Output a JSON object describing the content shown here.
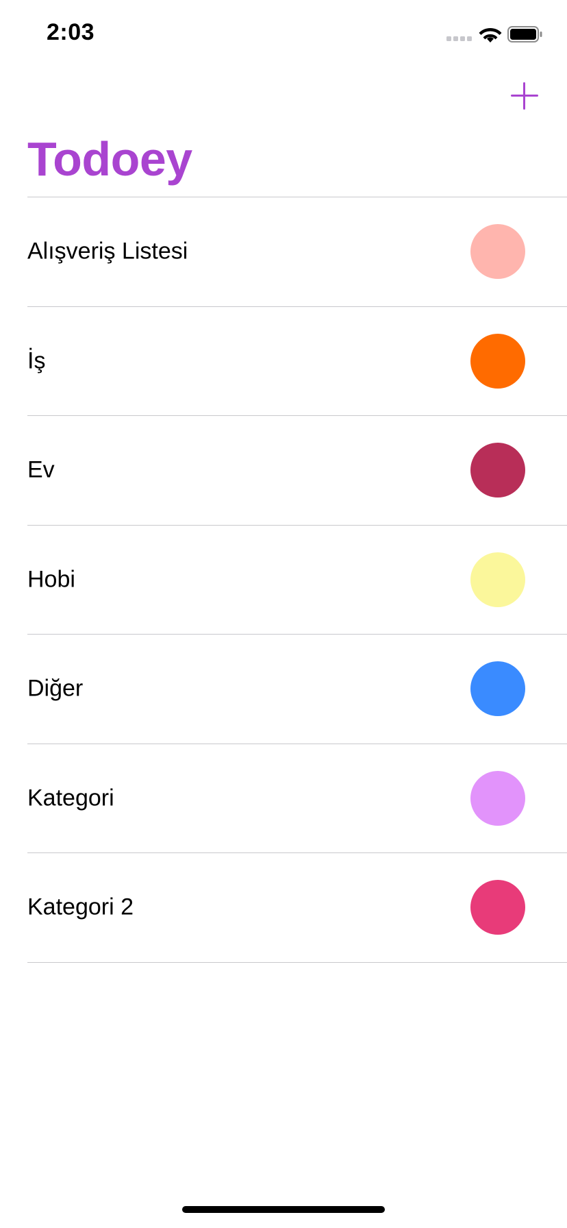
{
  "status_bar": {
    "time": "2:03",
    "icons": [
      "cellular-signal-icon",
      "wifi-icon",
      "battery-icon"
    ]
  },
  "nav": {
    "title": "Todoey",
    "add_icon": "plus-icon",
    "tint_color": "#a944d0"
  },
  "categories": [
    {
      "name": "Alışveriş Listesi",
      "color": "#ffb5ae"
    },
    {
      "name": "İş",
      "color": "#ff6b00"
    },
    {
      "name": "Ev",
      "color": "#b82e58"
    },
    {
      "name": "Hobi",
      "color": "#fbf79b"
    },
    {
      "name": "Diğer",
      "color": "#3a8bff"
    },
    {
      "name": "Kategori",
      "color": "#e293fb"
    },
    {
      "name": "Kategori 2",
      "color": "#e83b79"
    }
  ]
}
